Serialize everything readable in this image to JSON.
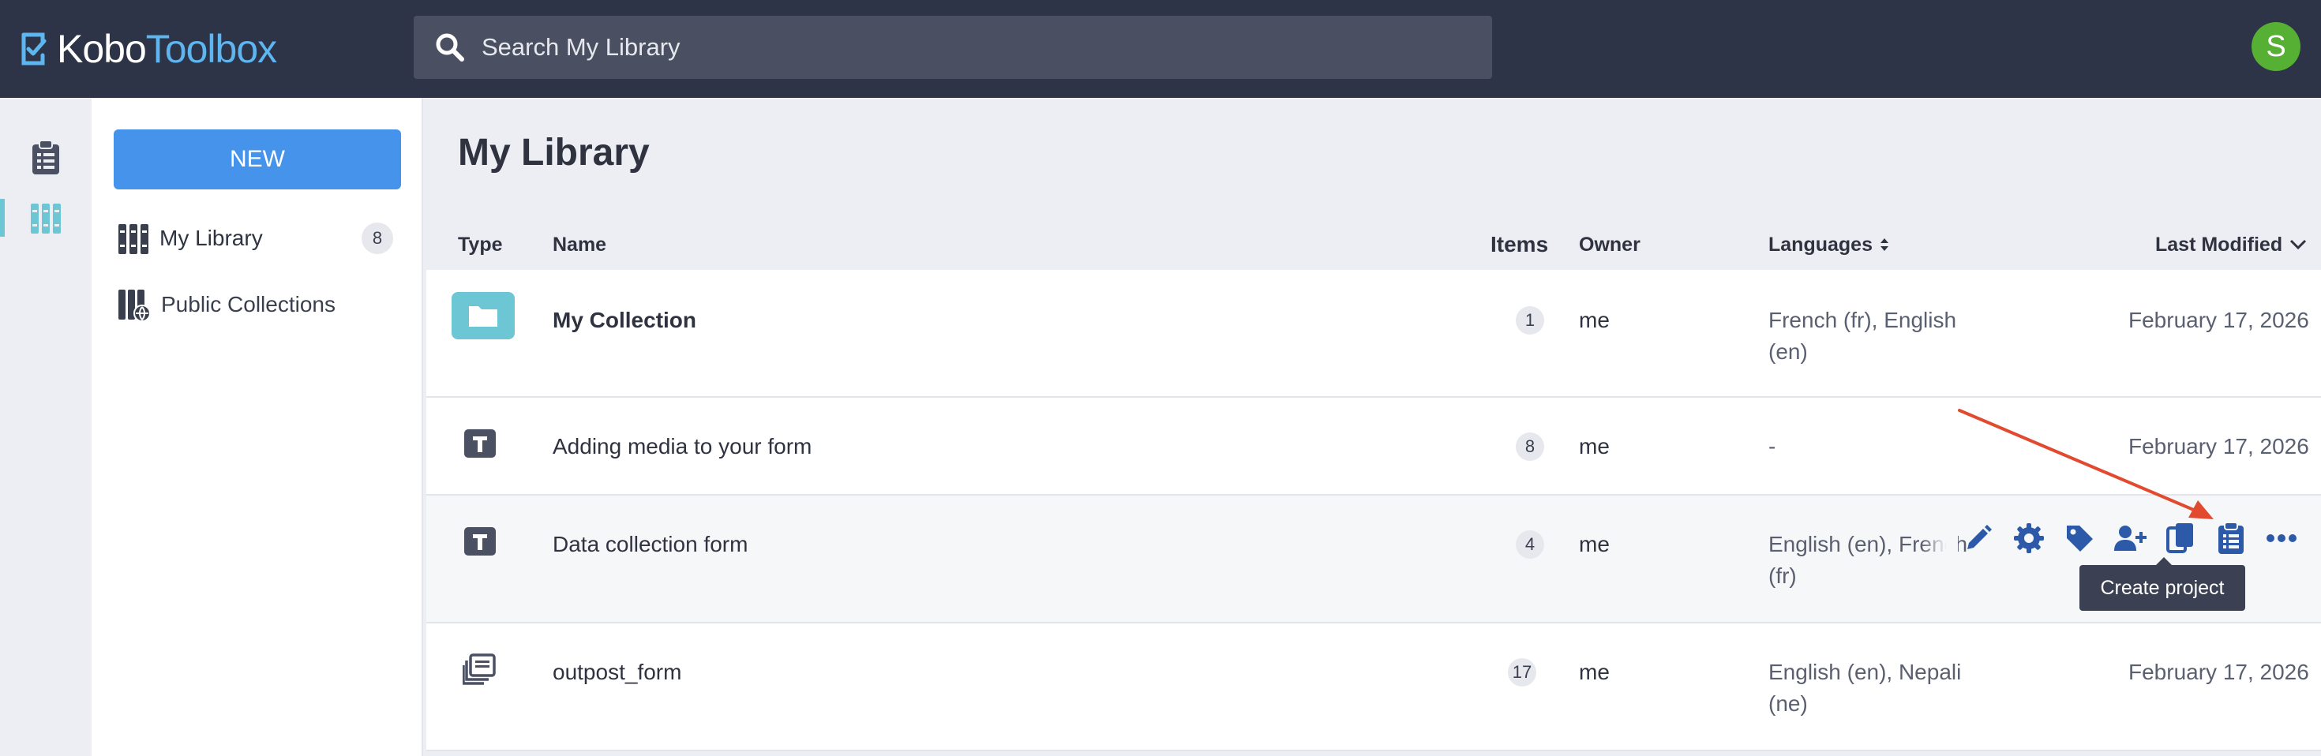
{
  "header": {
    "logo_kobo": "Kobo",
    "logo_toolbox": "Toolbox",
    "search_placeholder": "Search My Library",
    "avatar_initial": "S"
  },
  "rail": {
    "items": [
      {
        "icon": "clipboard-list-icon",
        "active": false
      },
      {
        "icon": "library-books-icon",
        "active": true
      }
    ]
  },
  "sidebar": {
    "new_label": "NEW",
    "links": [
      {
        "label": "My Library",
        "count": "8",
        "icon": "library-books-icon"
      },
      {
        "label": "Public Collections",
        "count": "",
        "icon": "public-collections-icon"
      }
    ]
  },
  "main": {
    "title": "My Library",
    "columns": {
      "type": "Type",
      "name": "Name",
      "items": "Items",
      "owner": "Owner",
      "languages": "Languages",
      "last_modified": "Last Modified"
    },
    "rows": [
      {
        "type": "collection",
        "name": "My Collection",
        "items": "1",
        "owner": "me",
        "languages_1": "French (fr), English",
        "languages_2": "(en)",
        "modified": "February 17, 2026"
      },
      {
        "type": "template",
        "name": "Adding media to your form",
        "items": "8",
        "owner": "me",
        "languages_1": "-",
        "languages_2": "",
        "modified": "February 17, 2026"
      },
      {
        "type": "template",
        "name": "Data collection form",
        "items": "4",
        "owner": "me",
        "languages_1": "English (en), French",
        "languages_2": "(fr)",
        "modified": ""
      },
      {
        "type": "survey",
        "name": "outpost_form",
        "items": "17",
        "owner": "me",
        "languages_1": "English (en), Nepali",
        "languages_2": "(ne)",
        "modified": "February 17, 2026"
      }
    ],
    "row_actions": [
      "edit-icon",
      "settings-icon",
      "tag-icon",
      "share-icon",
      "clone-icon",
      "create-project-icon",
      "more-icon"
    ],
    "tooltip": "Create project"
  },
  "colors": {
    "topbar": "#2e3447",
    "accent": "#4593ea",
    "teal": "#6cc6d4",
    "action_blue": "#2c5aa8",
    "annotation_arrow": "#e24a2f",
    "avatar": "#55b033"
  }
}
